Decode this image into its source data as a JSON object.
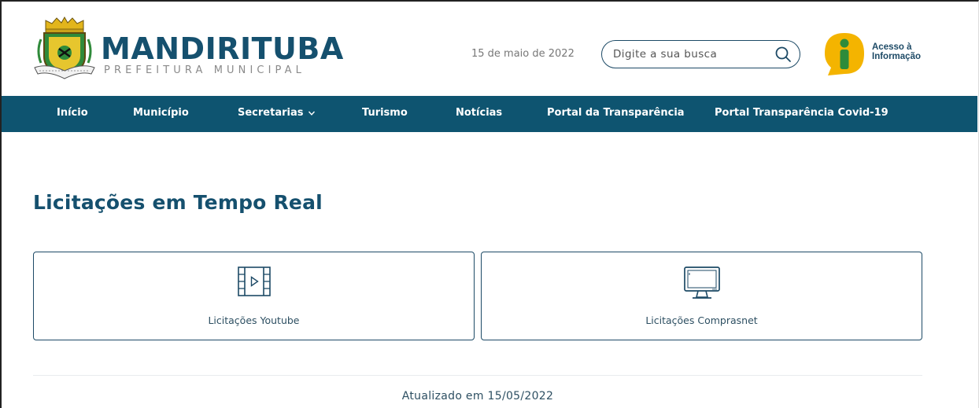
{
  "header": {
    "brand_name": "MANDIRITUBA",
    "brand_sub": "PREFEITURA MUNICIPAL",
    "date": "15 de maio de 2022",
    "search_placeholder": "Digite a sua busca",
    "access_line1": "Acesso à",
    "access_line2": "Informação"
  },
  "nav": {
    "items": [
      {
        "label": "Início"
      },
      {
        "label": "Município"
      },
      {
        "label": "Secretarias"
      },
      {
        "label": "Turismo"
      },
      {
        "label": "Notícias"
      },
      {
        "label": "Portal da Transparência"
      },
      {
        "label": "Portal Transparência Covid-19"
      }
    ]
  },
  "main": {
    "title": "Licitações em Tempo Real",
    "cards": [
      {
        "label": "Licitações Youtube",
        "icon": "video-film-icon"
      },
      {
        "label": "Licitações Comprasnet",
        "icon": "monitor-icon"
      }
    ],
    "updated": "Atualizado em 15/05/2022"
  },
  "colors": {
    "primary": "#0e5470",
    "title": "#15506e",
    "accent_yellow": "#f4b400",
    "accent_green": "#2e8b3a"
  }
}
